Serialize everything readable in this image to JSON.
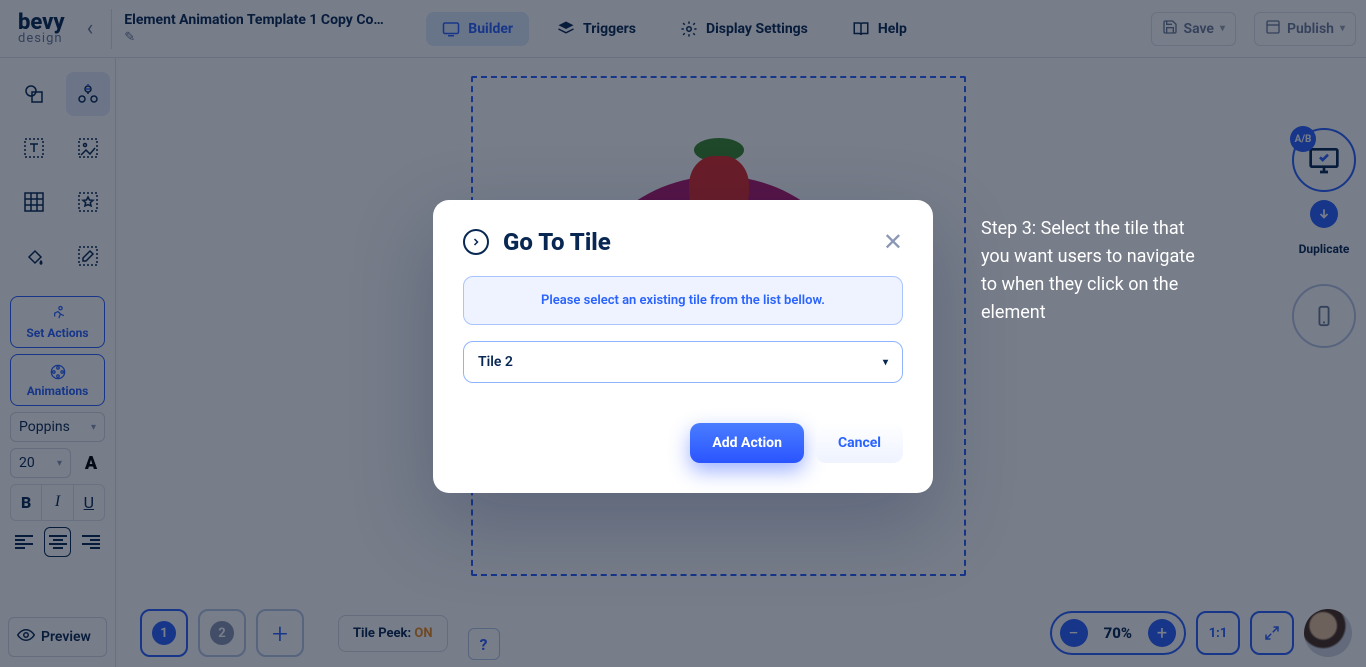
{
  "logo": {
    "top": "bevy",
    "sub": "design"
  },
  "document": {
    "title": "Element Animation Template 1 Copy Cop…"
  },
  "tabs": {
    "builder": "Builder",
    "triggers": "Triggers",
    "display_settings": "Display Settings",
    "help": "Help"
  },
  "top_right": {
    "save": "Save",
    "publish": "Publish"
  },
  "sidebar_buttons": {
    "set_actions": "Set Actions",
    "animations": "Animations"
  },
  "font": {
    "family": "Poppins",
    "size": "20"
  },
  "text_style": {
    "bold": "B",
    "italic": "I",
    "underline": "U"
  },
  "preview": "Preview",
  "right_dock": {
    "ab": "A/B",
    "duplicate": "Duplicate"
  },
  "bottom": {
    "tiles": [
      "1",
      "2"
    ],
    "peek_label": "Tile Peek: ",
    "peek_value": "ON",
    "zoom": "70%",
    "fit": "1:1"
  },
  "help_text": "Step 3: Select the tile that you want users to navigate to when they click on the element",
  "modal": {
    "title": "Go To Tile",
    "info": "Please select an existing tile from the list bellow.",
    "selected": "Tile 2",
    "add": "Add Action",
    "cancel": "Cancel"
  }
}
